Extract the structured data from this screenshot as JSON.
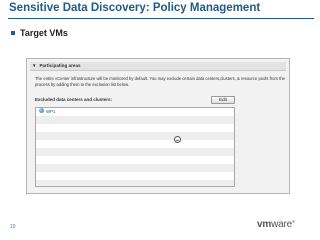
{
  "slide": {
    "title": "Sensitive Data Discovery: Policy Management",
    "bullet": "Target VMs",
    "page_number": "10",
    "logo_vm": "vm",
    "logo_ware": "ware",
    "logo_reg": "®"
  },
  "panel": {
    "section_header": "Participating areas",
    "description": "The entire vCenter infrastructure will be monitored by default. You may exclude certain data centers,clusters, & resource pools from the process by adding them to the exclusion list below.",
    "excluded_label": "Excluded data centers and clusters:",
    "edit_button": "Edit",
    "excluded_items": [
      {
        "name": "WP1"
      }
    ],
    "empty_rows": 9
  },
  "colors": {
    "title": "#1f5c88",
    "accent_blue": "#2f7fc1",
    "panel_bg": "#f2f2f2"
  },
  "icons": {
    "datacenter": "datacenter-icon",
    "cursor": "busy-cursor-icon",
    "collapse": "triangle-down-icon"
  }
}
